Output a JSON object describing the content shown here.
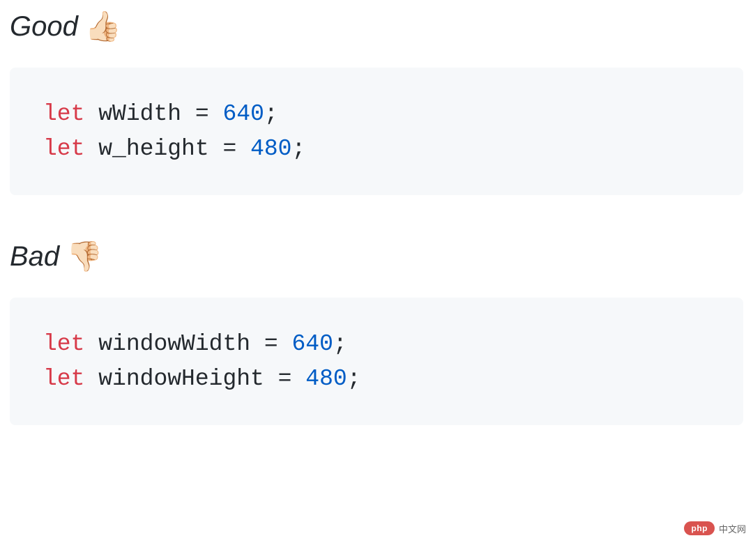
{
  "sections": [
    {
      "heading": "Good",
      "emoji": "👍🏻",
      "code": [
        [
          {
            "t": "let",
            "c": "keyword"
          },
          {
            "t": " wWidth = ",
            "c": "default"
          },
          {
            "t": "640",
            "c": "number"
          },
          {
            "t": ";",
            "c": "default"
          }
        ],
        [
          {
            "t": "let",
            "c": "keyword"
          },
          {
            "t": " w_height = ",
            "c": "default"
          },
          {
            "t": "480",
            "c": "number"
          },
          {
            "t": ";",
            "c": "default"
          }
        ]
      ]
    },
    {
      "heading": "Bad",
      "emoji": "👎🏻",
      "code": [
        [
          {
            "t": "let",
            "c": "keyword"
          },
          {
            "t": " windowWidth = ",
            "c": "default"
          },
          {
            "t": "640",
            "c": "number"
          },
          {
            "t": ";",
            "c": "default"
          }
        ],
        [
          {
            "t": "let",
            "c": "keyword"
          },
          {
            "t": " windowHeight = ",
            "c": "default"
          },
          {
            "t": "480",
            "c": "number"
          },
          {
            "t": ";",
            "c": "default"
          }
        ]
      ]
    }
  ],
  "watermark": {
    "badge": "php",
    "text": "中文网"
  }
}
